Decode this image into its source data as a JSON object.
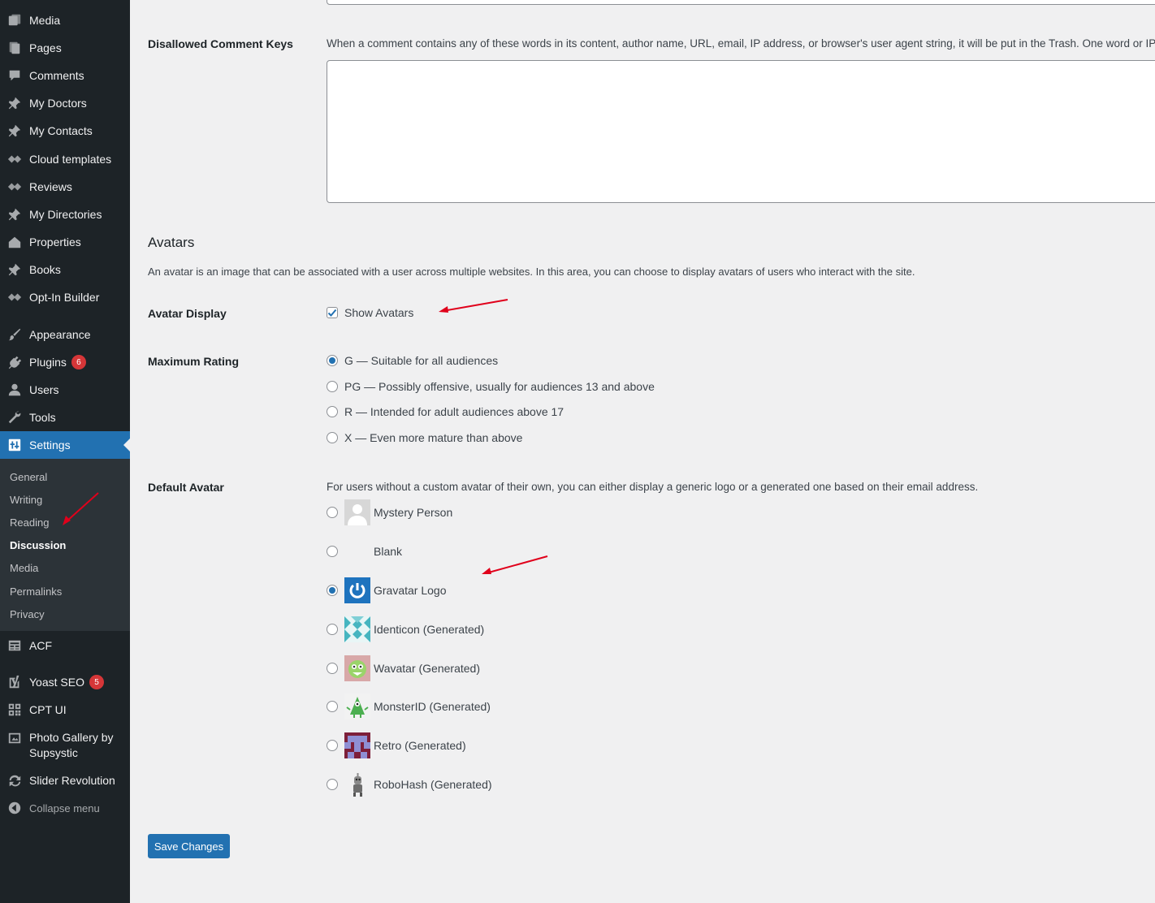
{
  "menu": {
    "media": "Media",
    "pages": "Pages",
    "comments": "Comments",
    "my_doctors": "My Doctors",
    "my_contacts": "My Contacts",
    "cloud_templates": "Cloud templates",
    "reviews": "Reviews",
    "my_directories": "My Directories",
    "properties": "Properties",
    "books": "Books",
    "optin_builder": "Opt-In Builder",
    "appearance": "Appearance",
    "plugins": "Plugins",
    "plugins_badge": "6",
    "users": "Users",
    "tools": "Tools",
    "settings": "Settings",
    "acf": "ACF",
    "yoast": "Yoast SEO",
    "yoast_badge": "5",
    "cpt_ui": "CPT UI",
    "photo_gallery_line1": "Photo Gallery by",
    "photo_gallery_line2": "Supsystic",
    "slider_revolution": "Slider Revolution",
    "collapse": "Collapse menu"
  },
  "submenu": {
    "general": "General",
    "writing": "Writing",
    "reading": "Reading",
    "discussion": "Discussion",
    "media": "Media",
    "permalinks": "Permalinks",
    "privacy": "Privacy"
  },
  "disallowed": {
    "label": "Disallowed Comment Keys",
    "description": "When a comment contains any of these words in its content, author name, URL, email, IP address, or browser's user agent string, it will be put in the Trash. One word or IP address per line.",
    "value": ""
  },
  "avatars": {
    "title": "Avatars",
    "description": "An avatar is an image that can be associated with a user across multiple websites. In this area, you can choose to display avatars of users who interact with the site.",
    "display_label": "Avatar Display",
    "show_avatars": "Show Avatars",
    "show_avatars_checked": true,
    "rating_label": "Maximum Rating",
    "ratings": [
      {
        "label": "G — Suitable for all audiences",
        "selected": true
      },
      {
        "label": "PG — Possibly offensive, usually for audiences 13 and above",
        "selected": false
      },
      {
        "label": "R — Intended for adult audiences above 17",
        "selected": false
      },
      {
        "label": "X — Even more mature than above",
        "selected": false
      }
    ],
    "default_label": "Default Avatar",
    "default_description": "For users without a custom avatar of their own, you can either display a generic logo or a generated one based on their email address.",
    "defaults": [
      {
        "label": "Mystery Person",
        "icon": "mystery-person-icon",
        "selected": false
      },
      {
        "label": "Blank",
        "icon": "blank-icon",
        "selected": false
      },
      {
        "label": "Gravatar Logo",
        "icon": "gravatar-logo-icon",
        "selected": true
      },
      {
        "label": "Identicon (Generated)",
        "icon": "identicon-icon",
        "selected": false
      },
      {
        "label": "Wavatar (Generated)",
        "icon": "wavatar-icon",
        "selected": false
      },
      {
        "label": "MonsterID (Generated)",
        "icon": "monsterid-icon",
        "selected": false
      },
      {
        "label": "Retro (Generated)",
        "icon": "retro-icon",
        "selected": false
      },
      {
        "label": "RoboHash (Generated)",
        "icon": "robohash-icon",
        "selected": false
      }
    ]
  },
  "save_button": "Save Changes",
  "colors": {
    "sidebar_bg": "#1d2327",
    "submenu_bg": "#2c3338",
    "accent": "#2271b1",
    "badge": "#d63638",
    "annotation_arrow": "#e0001b"
  }
}
